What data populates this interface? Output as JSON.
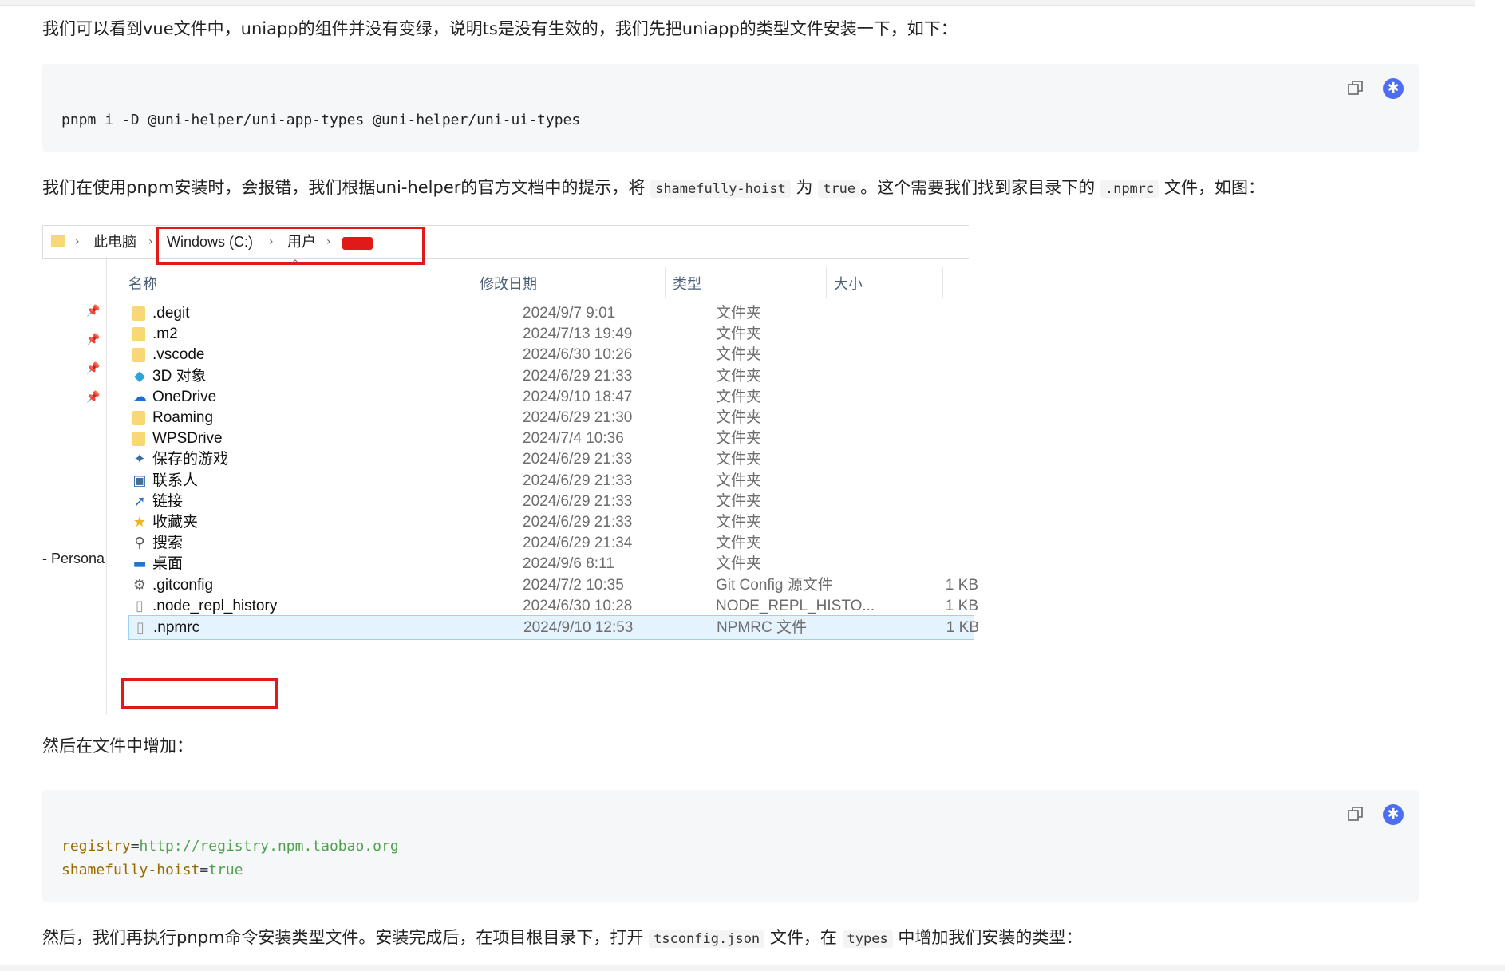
{
  "paragraphs": {
    "p1": "我们可以看到vue文件中，uniapp的组件并没有变绿，说明ts是没有生效的，我们先把uniapp的类型文件安装一下，如下：",
    "p2_a": "我们在使用pnpm安装时，会报错，我们根据uni-helper的官方文档中的提示，将 ",
    "p2_code1": "shamefully-hoist",
    "p2_b": " 为 ",
    "p2_code2": "true",
    "p2_c": "。这个需要我们找到家目录下的 ",
    "p2_code3": ".npmrc",
    "p2_d": " 文件，如图：",
    "p3": "然后在文件中增加：",
    "p4_a": "然后，我们再执行pnpm命令安装类型文件。安装完成后，在项目根目录下，打开 ",
    "p4_code1": "tsconfig.json",
    "p4_b": " 文件，在 ",
    "p4_code2": "types",
    "p4_c": " 中增加我们安装的类型："
  },
  "code_block_1": {
    "line1": "pnpm i -D @uni-helper/uni-app-types @uni-helper/uni-ui-types"
  },
  "code_block_2": {
    "line1_key": "registry",
    "line1_op": "=",
    "line1_val": "http://registry.npm.taobao.org",
    "line2_key": "shamefully-hoist",
    "line2_op": "=",
    "line2_val": "true"
  },
  "code_buttons": {
    "copy_icon": "copy-icon",
    "ai_icon": "ai-assistant-icon",
    "ai_glyph": "✱"
  },
  "explorer": {
    "breadcrumbs": [
      "此电脑",
      "Windows (C:)",
      "用户"
    ],
    "crumb_sep": "›",
    "nav_label": "- Persona",
    "columns": {
      "name": "名称",
      "date": "修改日期",
      "type": "类型",
      "size": "大小"
    },
    "sort_caret": "^",
    "files": [
      {
        "name": ".degit",
        "date": "2024/9/7 9:01",
        "type": "文件夹",
        "size": "",
        "icon": "folder-icon"
      },
      {
        "name": ".m2",
        "date": "2024/7/13 19:49",
        "type": "文件夹",
        "size": "",
        "icon": "folder-icon"
      },
      {
        "name": ".vscode",
        "date": "2024/6/30 10:26",
        "type": "文件夹",
        "size": "",
        "icon": "folder-icon"
      },
      {
        "name": "3D 对象",
        "date": "2024/6/29 21:33",
        "type": "文件夹",
        "size": "",
        "icon": "3d-objects-icon"
      },
      {
        "name": "OneDrive",
        "date": "2024/9/10 18:47",
        "type": "文件夹",
        "size": "",
        "icon": "onedrive-cloud-icon"
      },
      {
        "name": "Roaming",
        "date": "2024/6/29 21:30",
        "type": "文件夹",
        "size": "",
        "icon": "folder-icon"
      },
      {
        "name": "WPSDrive",
        "date": "2024/7/4 10:36",
        "type": "文件夹",
        "size": "",
        "icon": "folder-icon"
      },
      {
        "name": "保存的游戏",
        "date": "2024/6/29 21:33",
        "type": "文件夹",
        "size": "",
        "icon": "saved-games-icon"
      },
      {
        "name": "联系人",
        "date": "2024/6/29 21:33",
        "type": "文件夹",
        "size": "",
        "icon": "contacts-icon"
      },
      {
        "name": "链接",
        "date": "2024/6/29 21:33",
        "type": "文件夹",
        "size": "",
        "icon": "links-icon"
      },
      {
        "name": "收藏夹",
        "date": "2024/6/29 21:33",
        "type": "文件夹",
        "size": "",
        "icon": "favorites-star-icon"
      },
      {
        "name": "搜索",
        "date": "2024/6/29 21:34",
        "type": "文件夹",
        "size": "",
        "icon": "search-icon"
      },
      {
        "name": "桌面",
        "date": "2024/9/6 8:11",
        "type": "文件夹",
        "size": "",
        "icon": "desktop-icon"
      },
      {
        "name": ".gitconfig",
        "date": "2024/7/2 10:35",
        "type": "Git Config 源文件",
        "size": "1 KB",
        "icon": "gear-file-icon"
      },
      {
        "name": ".node_repl_history",
        "date": "2024/6/30 10:28",
        "type": "NODE_REPL_HISTO...",
        "size": "1 KB",
        "icon": "file-icon"
      },
      {
        "name": ".npmrc",
        "date": "2024/9/10 12:53",
        "type": "NPMRC 文件",
        "size": "1 KB",
        "icon": "file-icon"
      }
    ]
  },
  "colors": {
    "highlight_red": "#e01919",
    "folder_yellow": "#f8d775",
    "selection_bg": "#e5f3ff",
    "code_bg": "#f6f7f8"
  }
}
